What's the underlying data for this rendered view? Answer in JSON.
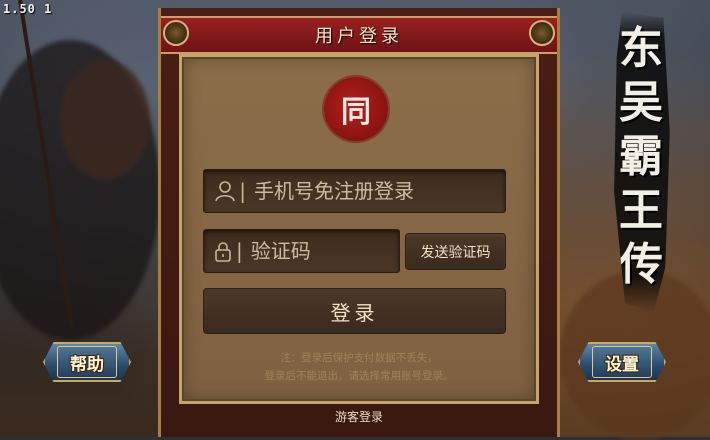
{
  "version": "1.50 1",
  "panel": {
    "title": "用户登录",
    "logo_char": "同",
    "phone_placeholder": "手机号免注册登录",
    "code_placeholder": "验证码",
    "send_code_label": "发送验证码",
    "login_label": "登录",
    "notice_line1": "注：登录后保护支付数据不丢失，",
    "notice_line2": "登录后不能退出，请选择常用账号登录。",
    "guest_label": "游客登录"
  },
  "side": {
    "help_label": "帮助",
    "settings_label": "设置"
  },
  "title_chars": [
    "东",
    "吴",
    "霸",
    "王",
    "传"
  ],
  "icons": {
    "user": "user-icon",
    "lock": "lock-icon"
  },
  "colors": {
    "header_red": "#9a1f20",
    "panel_tan": "#8c6d48",
    "button_dark": "#3a2a1d",
    "gold_trim": "#c6a46c"
  }
}
